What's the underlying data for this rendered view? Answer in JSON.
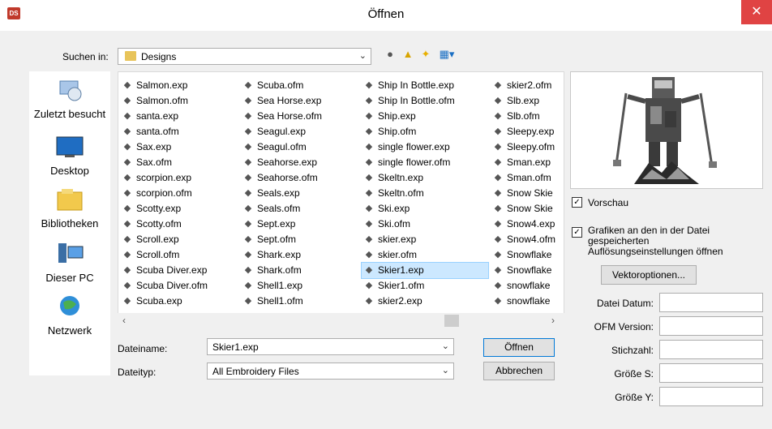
{
  "window": {
    "title": "Öffnen",
    "app_icon_text": "DS",
    "close_glyph": "✕"
  },
  "lookin": {
    "label": "Suchen in:",
    "value": "Designs"
  },
  "toolbar_icons": [
    "back-icon",
    "up-folder-icon",
    "new-folder-icon",
    "view-menu-icon"
  ],
  "places": [
    {
      "label": "Zuletzt besucht",
      "icon": "recent-places-icon"
    },
    {
      "label": "Desktop",
      "icon": "desktop-icon"
    },
    {
      "label": "Bibliotheken",
      "icon": "libraries-icon"
    },
    {
      "label": "Dieser PC",
      "icon": "computer-icon"
    },
    {
      "label": "Netzwerk",
      "icon": "network-icon"
    }
  ],
  "files": {
    "col1": [
      "Salmon.exp",
      "Salmon.ofm",
      "santa.exp",
      "santa.ofm",
      "Sax.exp",
      "Sax.ofm",
      "scorpion.exp",
      "scorpion.ofm",
      "Scotty.exp",
      "Scotty.ofm",
      "Scroll.exp",
      "Scroll.ofm",
      "Scuba Diver.exp",
      "Scuba Diver.ofm",
      "Scuba.exp"
    ],
    "col2": [
      "Scuba.ofm",
      "Sea Horse.exp",
      "Sea Horse.ofm",
      "Seagul.exp",
      "Seagul.ofm",
      "Seahorse.exp",
      "Seahorse.ofm",
      "Seals.exp",
      "Seals.ofm",
      "Sept.exp",
      "Sept.ofm",
      "Shark.exp",
      "Shark.ofm",
      "Shell1.exp",
      "Shell1.ofm"
    ],
    "col3": [
      "Ship In Bottle.exp",
      "Ship In Bottle.ofm",
      "Ship.exp",
      "Ship.ofm",
      "single flower.exp",
      "single flower.ofm",
      "Skeltn.exp",
      "Skeltn.ofm",
      "Ski.exp",
      "Ski.ofm",
      "skier.exp",
      "skier.ofm",
      "Skier1.exp",
      "Skier1.ofm",
      "skier2.exp"
    ],
    "col4": [
      "skier2.ofm",
      "Slb.exp",
      "Slb.ofm",
      "Sleepy.exp",
      "Sleepy.ofm",
      "Sman.exp",
      "Sman.ofm",
      "Snow Skie",
      "Snow Skie",
      "Snow4.exp",
      "Snow4.ofm",
      "Snowflake",
      "Snowflake",
      "snowflake",
      "snowflake"
    ],
    "selected": "Skier1.exp"
  },
  "scroll": {
    "left": "‹",
    "right": "›"
  },
  "filename": {
    "label": "Dateiname:",
    "value": "Skier1.exp"
  },
  "filetype": {
    "label": "Dateityp:",
    "value": "All Embroidery Files"
  },
  "buttons": {
    "open": "Öffnen",
    "cancel": "Abbrechen",
    "vector": "Vektoroptionen..."
  },
  "options": {
    "preview": {
      "label": "Vorschau",
      "checked": true
    },
    "graphics": {
      "line1": "Grafiken an den in der Datei",
      "line2": "gespeicherten",
      "line3": "Auflösungseinstellungen öffnen",
      "checked": true
    }
  },
  "info_fields": [
    "Datei Datum:",
    "OFM Version:",
    "Stichzahl:",
    "Größe S:",
    "Größe Y:"
  ],
  "colors": {
    "accent": "#0078d7",
    "close": "#e04343",
    "selection": "#cce8ff"
  }
}
